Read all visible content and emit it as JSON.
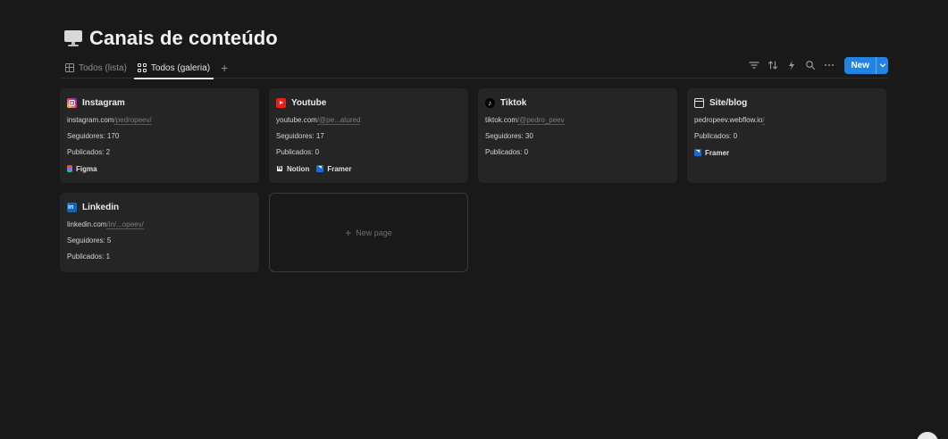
{
  "page": {
    "title": "Canais de conteúdo",
    "icon": "desktop-computer-icon"
  },
  "tabs": [
    {
      "label": "Todos (lista)",
      "icon": "table-icon",
      "active": false
    },
    {
      "label": "Todos (galeria)",
      "icon": "gallery-icon",
      "active": true
    }
  ],
  "add_tab_label": "+",
  "actions": {
    "icons": [
      "filter-icon",
      "sort-icon",
      "automation-icon",
      "search-icon",
      "more-icon"
    ],
    "new_label": "New"
  },
  "colors": {
    "background": "#191919",
    "card": "#252525",
    "accent": "#2383e2"
  },
  "cards": [
    {
      "name": "Instagram",
      "icon": "instagram-icon",
      "url_domain": "instagram.com",
      "url_path": "/pedropeev/",
      "followers": "Seguidores: 170",
      "published": "Publicados: 2",
      "tags": [
        {
          "label": "Figma",
          "icon": "figma-icon"
        }
      ]
    },
    {
      "name": "Youtube",
      "icon": "youtube-icon",
      "url_domain": "youtube.com",
      "url_path": "/@pe...atured",
      "followers": "Seguidores: 17",
      "published": "Publicados: 0",
      "tags": [
        {
          "label": "Notion",
          "icon": "notion-icon"
        },
        {
          "label": "Framer",
          "icon": "framer-icon"
        }
      ]
    },
    {
      "name": "Tiktok",
      "icon": "tiktok-icon",
      "url_domain": "tiktok.com",
      "url_path": "/@pedro_peev",
      "followers": "Seguidores: 30",
      "published": "Publicados: 0",
      "tags": []
    },
    {
      "name": "Site/blog",
      "icon": "browser-window-icon",
      "url_domain": "pedropeev.webflow.io",
      "url_path": "/",
      "published": "Publicados: 0",
      "tags": [
        {
          "label": "Framer",
          "icon": "framer-icon"
        }
      ]
    },
    {
      "name": "Linkedin",
      "icon": "linkedin-icon",
      "url_domain": "linkedin.com",
      "url_path": "/in/...opeev/",
      "followers": "Seguidores: 5",
      "published": "Publicados: 1",
      "tags": []
    }
  ],
  "new_page_label": "New page"
}
